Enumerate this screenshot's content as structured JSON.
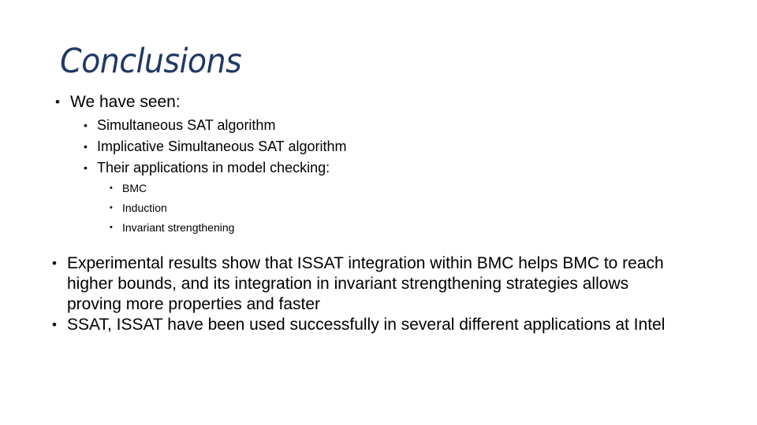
{
  "slide": {
    "title": "Conclusions",
    "title_color": "#203864",
    "background_color": "#FFFFFF",
    "body_text_color": "#000000",
    "bullet_glyph": "•"
  },
  "content": {
    "groups": [
      {
        "id": "seen-group",
        "level1": {
          "text": "We have seen:"
        },
        "level2": [
          {
            "text": "Simultaneous SAT algorithm"
          },
          {
            "text": "Implicative Simultaneous SAT algorithm"
          },
          {
            "text": "Their applications in model checking:"
          }
        ],
        "level3": [
          {
            "text": "BMC"
          },
          {
            "text": "Induction"
          },
          {
            "text": "Invariant strengthening"
          }
        ]
      }
    ],
    "paragraphs": [
      {
        "id": "experimental-results",
        "text": "Experimental results show that ISSAT integration within BMC helps BMC to reach higher bounds, and its integration in invariant strengthening strategies allows proving more properties and faster"
      },
      {
        "id": "ssat-usage",
        "text": "SSAT, ISSAT have been used successfully in several different applications at Intel"
      }
    ]
  }
}
